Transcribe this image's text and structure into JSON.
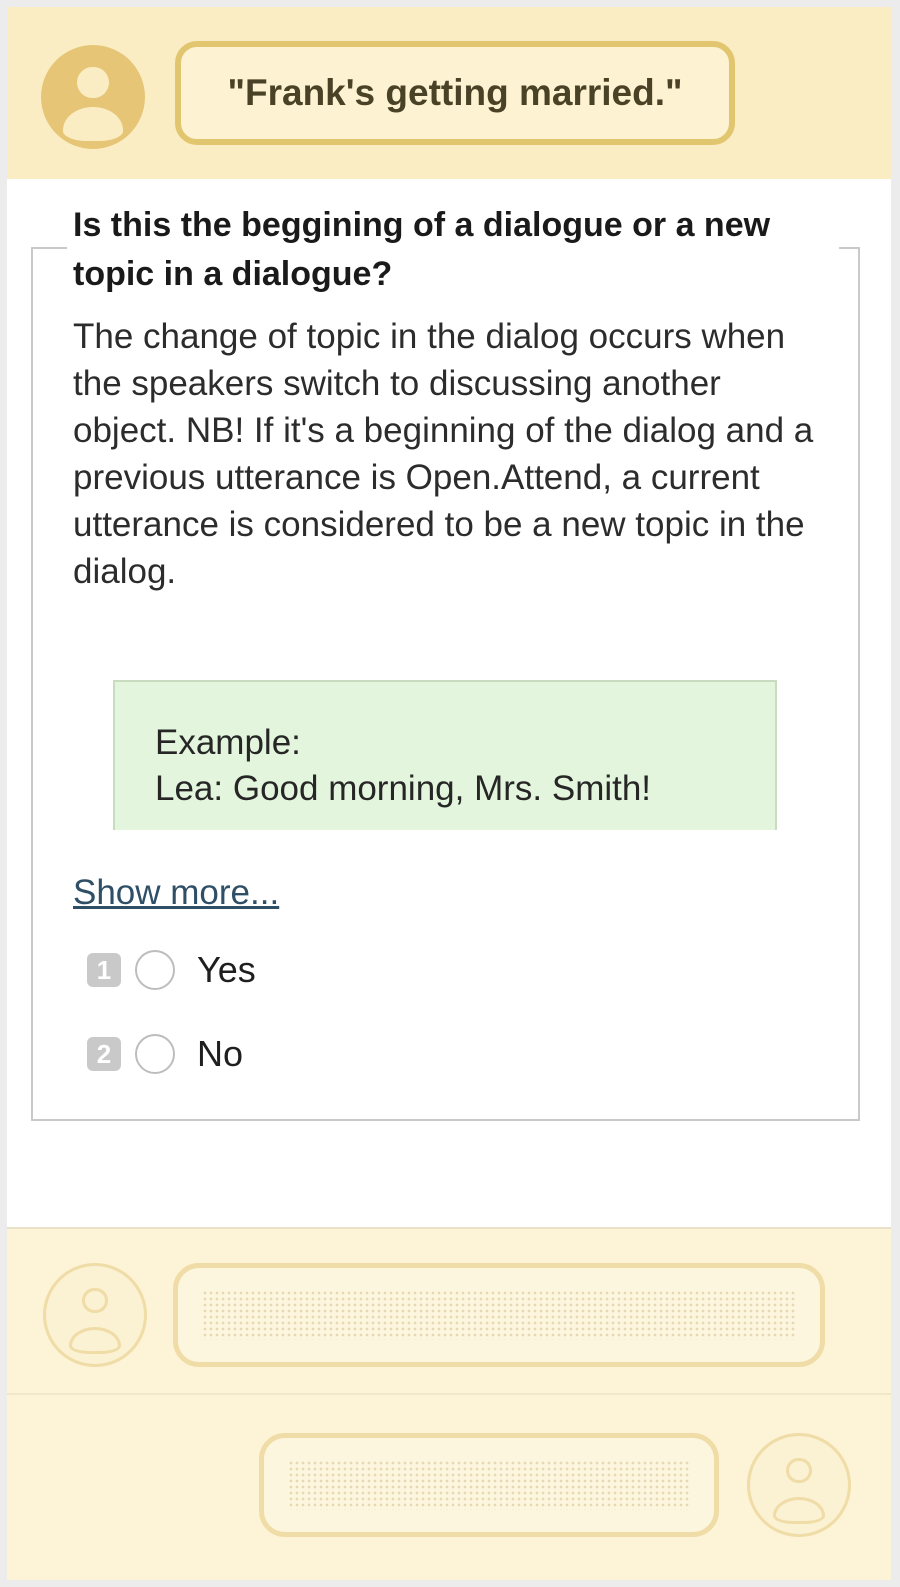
{
  "speaker": {
    "avatar_icon": "user-avatar-icon",
    "utterance": "\"Frank's getting married.\""
  },
  "question": {
    "title": "Is this the beggining of a dialogue or a new topic in a dialogue?",
    "description": "The change of topic in the dialog occurs when the speakers switch to discussing another object. NB! If it's a beginning of the dialog and a previous utterance is Open.Attend, a current utterance is considered to be a new topic in the dialog.",
    "example_heading": "Example:",
    "example_line": "Lea: Good morning, Mrs. Smith!",
    "show_more": "Show more...",
    "options": [
      {
        "hotkey": "1",
        "label": "Yes"
      },
      {
        "hotkey": "2",
        "label": "No"
      }
    ]
  },
  "colors": {
    "band": "#fbedc3",
    "bubble_border": "#e2c66f",
    "example_bg": "#e3f5dc",
    "link": "#2f4f66"
  }
}
